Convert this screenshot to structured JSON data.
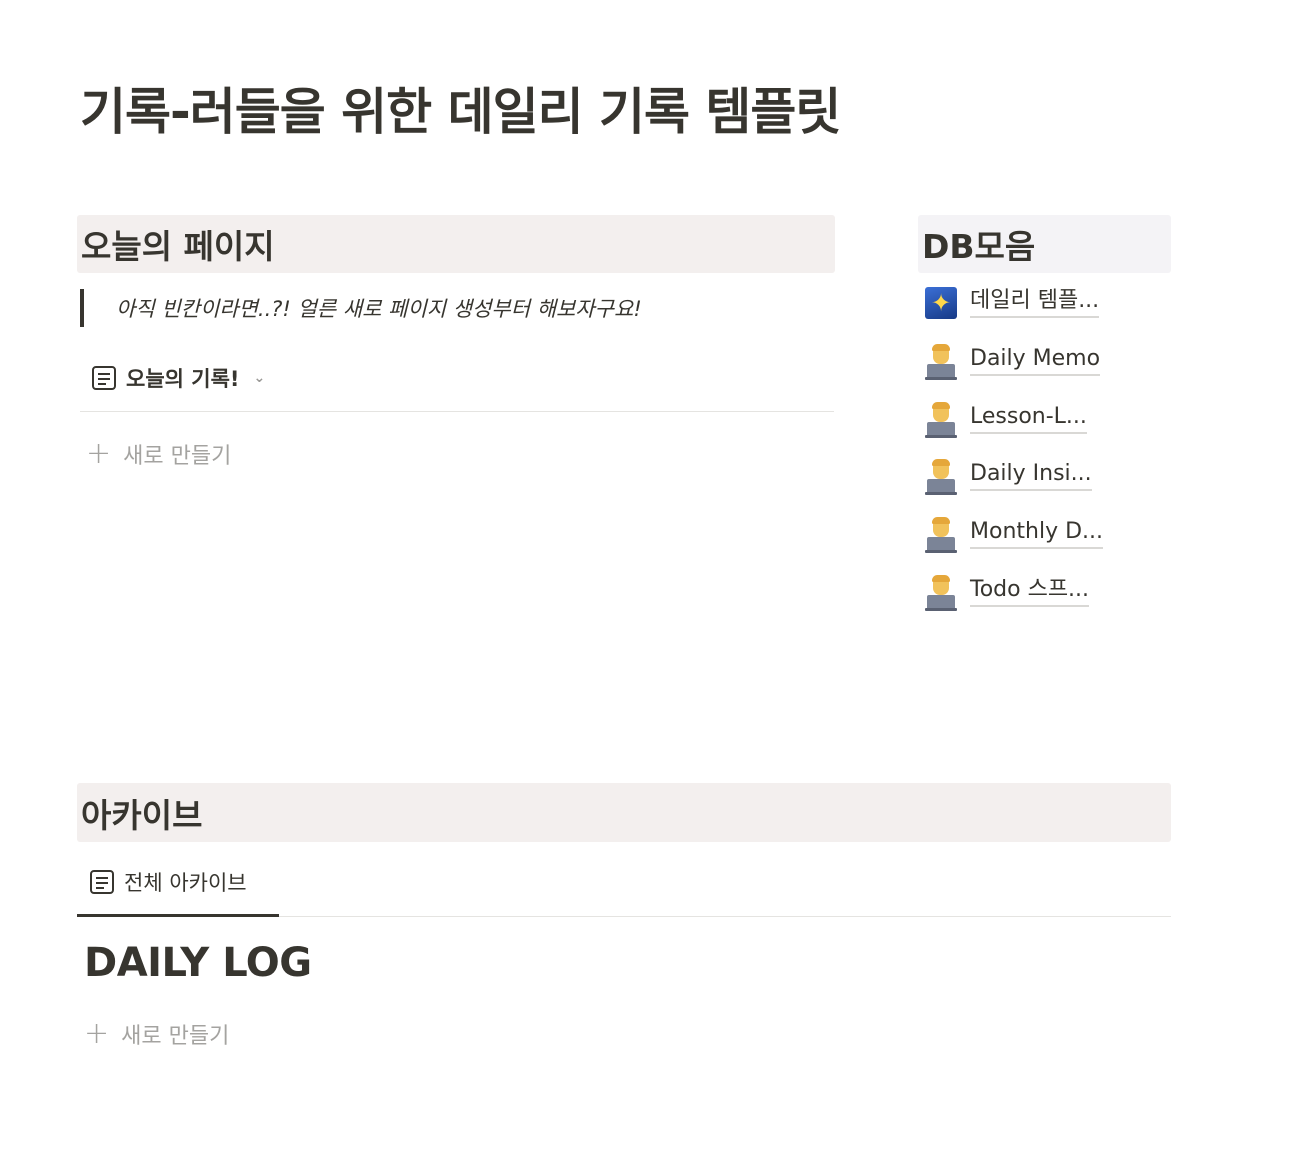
{
  "page": {
    "title": "기록-러들을 위한 데일리 기록 템플릿"
  },
  "today": {
    "heading": "오늘의 페이지",
    "quote": "아직 빈칸이라면..?! 얼른 새로 페이지 생성부터 해보자구요!",
    "view_tab": "오늘의 기록!",
    "view_icon": "page-icon",
    "dropdown_icon": "chevron-down-icon",
    "new_label": "새로 만들기"
  },
  "db": {
    "heading": "DB모음",
    "items": [
      {
        "label": "데일리 템플...",
        "icon": "shooting-star-emoji"
      },
      {
        "label": "Daily Memo",
        "icon": "technologist-emoji"
      },
      {
        "label": "Lesson-L...",
        "icon": "technologist-emoji"
      },
      {
        "label": "Daily Insi...",
        "icon": "technologist-emoji"
      },
      {
        "label": "Monthly D...",
        "icon": "technologist-emoji"
      },
      {
        "label": "Todo 스프...",
        "icon": "technologist-emoji"
      }
    ]
  },
  "archive": {
    "heading": "아카이브",
    "view_tab": "전체 아카이브",
    "group_title": "DAILY LOG",
    "new_label": "새로 만들기"
  }
}
